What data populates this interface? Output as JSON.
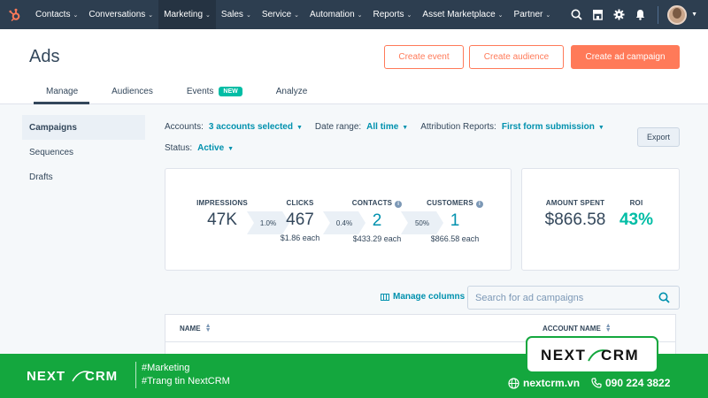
{
  "nav": {
    "logo_icon": "hubspot-sprocket-icon",
    "items": [
      {
        "label": "Contacts"
      },
      {
        "label": "Conversations"
      },
      {
        "label": "Marketing"
      },
      {
        "label": "Sales"
      },
      {
        "label": "Service"
      },
      {
        "label": "Automation"
      },
      {
        "label": "Reports"
      },
      {
        "label": "Asset Marketplace"
      },
      {
        "label": "Partner"
      }
    ],
    "active": "Marketing",
    "right_icons": [
      "search-icon",
      "marketplace-icon",
      "settings-gear-icon",
      "notifications-bell-icon"
    ]
  },
  "header": {
    "title": "Ads",
    "buttons": {
      "create_event": "Create event",
      "create_audience": "Create audience",
      "create_campaign": "Create ad campaign"
    },
    "tabs": [
      {
        "label": "Manage"
      },
      {
        "label": "Audiences"
      },
      {
        "label": "Events",
        "badge": "NEW"
      },
      {
        "label": "Analyze"
      }
    ],
    "active_tab": "Manage"
  },
  "sidebar": {
    "items": [
      {
        "label": "Campaigns"
      },
      {
        "label": "Sequences"
      },
      {
        "label": "Drafts"
      }
    ],
    "active": "Campaigns"
  },
  "filters": {
    "accounts_label": "Accounts:",
    "accounts_value": "3 accounts selected",
    "date_label": "Date range:",
    "date_value": "All time",
    "attribution_label": "Attribution Reports:",
    "attribution_value": "First form submission",
    "status_label": "Status:",
    "status_value": "Active",
    "export_label": "Export"
  },
  "funnel": {
    "impressions": {
      "label": "IMPRESSIONS",
      "value": "47K"
    },
    "clicks": {
      "label": "CLICKS",
      "value": "467",
      "sub": "$1.86 each"
    },
    "contacts": {
      "label": "CONTACTS",
      "value": "2",
      "sub": "$433.29 each"
    },
    "customers": {
      "label": "CUSTOMERS",
      "value": "1",
      "sub": "$866.58 each"
    },
    "rates": {
      "ctr": "1.0%",
      "contact_rate": "0.4%",
      "customer_rate": "50%"
    }
  },
  "spend": {
    "amount_label": "AMOUNT SPENT",
    "amount_value": "$866.58",
    "roi_label": "ROI",
    "roi_value": "43%"
  },
  "table": {
    "manage_columns": "Manage columns",
    "search_placeholder": "Search for ad campaigns",
    "headers": {
      "name": "NAME",
      "account": "ACCOUNT NAME"
    }
  },
  "banner": {
    "brand": "NEXTCRM",
    "tags": [
      "#Marketing",
      "#Trang tin NextCRM"
    ],
    "website": "nextcrm.vn",
    "phone": "090 224 3822",
    "colors": {
      "green": "#14a73e"
    }
  },
  "colors": {
    "nav_bg": "#2d3e50",
    "accent": "#ff7a59",
    "link": "#0091ae",
    "teal": "#00bda5"
  }
}
